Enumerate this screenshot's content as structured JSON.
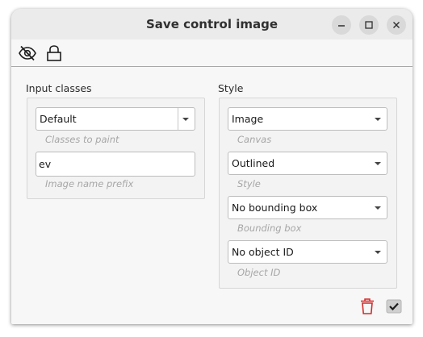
{
  "window": {
    "title": "Save control image"
  },
  "toolbar": {
    "icons": [
      "eye-slash-icon",
      "padlock-icon"
    ]
  },
  "input_classes": {
    "label": "Input classes",
    "classes_combo": {
      "value": "Default",
      "hint": "Classes to paint"
    },
    "prefix_field": {
      "value": "ev",
      "hint": "Image name prefix"
    }
  },
  "style": {
    "label": "Style",
    "canvas_combo": {
      "value": "Image",
      "hint": "Canvas"
    },
    "style_combo": {
      "value": "Outlined",
      "hint": "Style"
    },
    "bbox_combo": {
      "value": "No bounding box",
      "hint": "Bounding box"
    },
    "objid_combo": {
      "value": "No object ID",
      "hint": "Object ID"
    }
  },
  "actions": {
    "delete_icon": "trash-icon",
    "apply_icon": "checkmark-icon"
  },
  "colors": {
    "delete": "#d02b2b",
    "titlebar": "#ebebeb",
    "window": "#f7f7f7"
  }
}
